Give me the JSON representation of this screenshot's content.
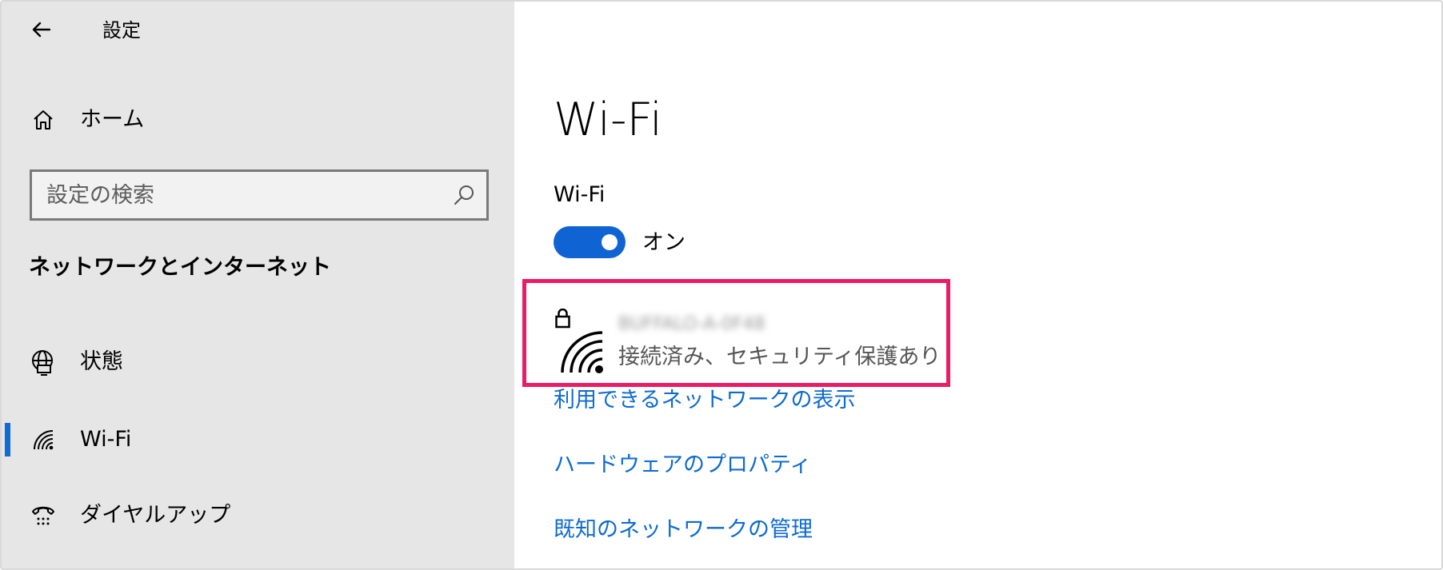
{
  "app": {
    "title": "設定",
    "back_icon": "back-arrow-icon"
  },
  "sidebar": {
    "home": {
      "label": "ホーム",
      "icon": "home-icon"
    },
    "search": {
      "value": "",
      "placeholder": "設定の検索",
      "icon": "search-icon"
    },
    "section_title": "ネットワークとインターネット",
    "items": [
      {
        "label": "状態",
        "icon": "globe-status-icon",
        "active": false
      },
      {
        "label": "Wi-Fi",
        "icon": "wifi-icon",
        "active": true
      },
      {
        "label": "ダイヤルアップ",
        "icon": "dialup-icon",
        "active": false
      }
    ],
    "active_color": "#0f6cd5"
  },
  "main": {
    "title": "Wi-Fi",
    "wifi_toggle": {
      "label": "Wi-Fi",
      "state_label": "オン",
      "on": true,
      "color": "#0f63d3"
    },
    "current_network": {
      "name": "BUFFALO-A-0F48",
      "status": "接続済み、セキュリティ保護あり",
      "icon": "secured-wifi-icon",
      "highlight_color": "#ea1c65"
    },
    "links": [
      {
        "label": "利用できるネットワークの表示"
      },
      {
        "label": "ハードウェアのプロパティ"
      },
      {
        "label": "既知のネットワークの管理"
      }
    ],
    "link_color": "#0d6bd1"
  }
}
